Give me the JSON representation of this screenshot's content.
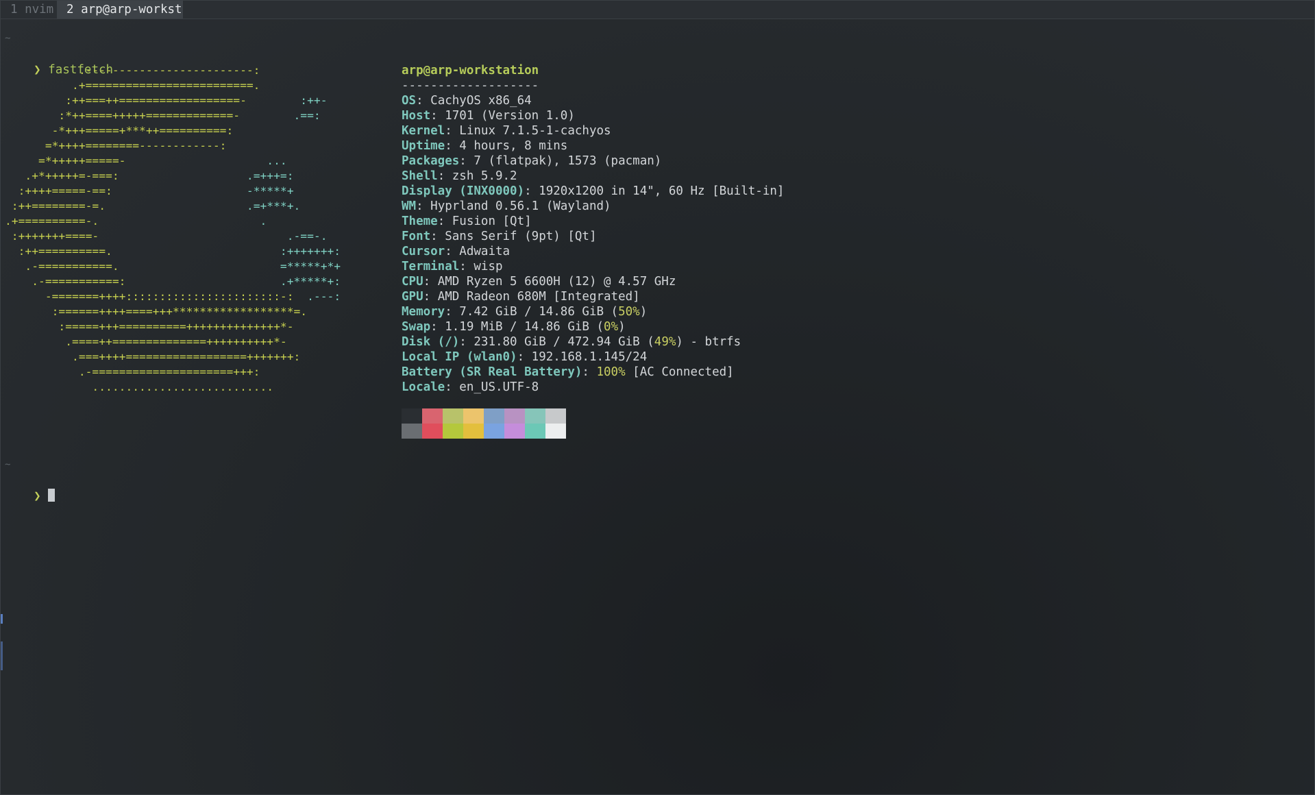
{
  "tabs": [
    {
      "label": "1 nvim",
      "active": false
    },
    {
      "label": "2 arp@arp-workst",
      "active": true
    }
  ],
  "terminal": {
    "tilde": "~",
    "prompt_symbol": "❯",
    "command": "fastfetch"
  },
  "logo_lines": [
    "           .-------------------------:",
    "          .+=========================.",
    "         :++===++==================-        :++-",
    "        :*++====+++++=============-        .==:",
    "       -*+++=====+***++==========:",
    "      =*++++========------------:",
    "     =*+++++=====-                     ...",
    "   .+*+++++=-===:                   .=+++=:",
    "  :++++=====-==:                    -*****+",
    " :++========-=.                     .=+***+.",
    ".+==========-.                        .",
    " :+++++++====-                            .-==-.",
    "  :++==========.                         :+++++++:",
    "   .-===========.                        =*****+*+",
    "    .-===========:                       .+*****+:",
    "      -=======++++:::::::::::::::::::::::-:  .---:",
    "       :======++++====+++******************=.",
    "        :=====+++==========++++++++++++++*-",
    "         .====++==============++++++++++*-",
    "          .===++++==================+++++++:",
    "           .-=====================+++:",
    "             ..........................."
  ],
  "info": {
    "title": "arp@arp-workstation",
    "separator": "-------------------",
    "rows": [
      {
        "key": "OS",
        "value": "CachyOS x86_64"
      },
      {
        "key": "Host",
        "value": "1701 (Version 1.0)"
      },
      {
        "key": "Kernel",
        "value": "Linux 7.1.5-1-cachyos"
      },
      {
        "key": "Uptime",
        "value": "4 hours, 8 mins"
      },
      {
        "key": "Packages",
        "value": "7 (flatpak), 1573 (pacman)"
      },
      {
        "key": "Shell",
        "value": "zsh 5.9.2"
      },
      {
        "key": "Display (INX0000)",
        "value": "1920x1200 in 14\", 60 Hz [Built-in]"
      },
      {
        "key": "WM",
        "value": "Hyprland 0.56.1 (Wayland)"
      },
      {
        "key": "Theme",
        "value": "Fusion [Qt]"
      },
      {
        "key": "Font",
        "value": "Sans Serif (9pt) [Qt]"
      },
      {
        "key": "Cursor",
        "value": "Adwaita"
      },
      {
        "key": "Terminal",
        "value": "wisp"
      },
      {
        "key": "CPU",
        "value": "AMD Ryzen 5 6600H (12) @ 4.57 GHz"
      },
      {
        "key": "GPU",
        "value": "AMD Radeon 680M [Integrated]"
      },
      {
        "key": "Memory",
        "value_pre": "7.42 GiB / 14.86 GiB (",
        "value_pct": "50%",
        "value_post": ")"
      },
      {
        "key": "Swap",
        "value_pre": "1.19 MiB / 14.86 GiB (",
        "value_pct": "0%",
        "value_post": ")"
      },
      {
        "key": "Disk (/)",
        "value_pre": "231.80 GiB / 472.94 GiB (",
        "value_pct": "49%",
        "value_post": ") - btrfs"
      },
      {
        "key": "Local IP (wlan0)",
        "value": "192.168.1.145/24"
      },
      {
        "key": "Battery (SR Real Battery)",
        "value_pre": "",
        "value_pct": "100%",
        "value_post": " [AC Connected]"
      },
      {
        "key": "Locale",
        "value": "en_US.UTF-8"
      }
    ]
  },
  "palette": {
    "top": [
      "#2a2e32",
      "#d9646f",
      "#b8c26a",
      "#ecc46c",
      "#7f9fc6",
      "#b892c2",
      "#86c5b9",
      "#c7c9cb"
    ],
    "bottom": [
      "#6a6e72",
      "#e04e5c",
      "#b4c83c",
      "#e3bf3d",
      "#7aa3e0",
      "#c58ddb",
      "#6cc8b6",
      "#eceeef"
    ]
  },
  "colors": {
    "background": "#23272b",
    "accent_key": "#7fc8bd",
    "accent_title": "#b6cc5a",
    "logo_green": "#c7d04f",
    "logo_teal": "#7fd1c3"
  }
}
